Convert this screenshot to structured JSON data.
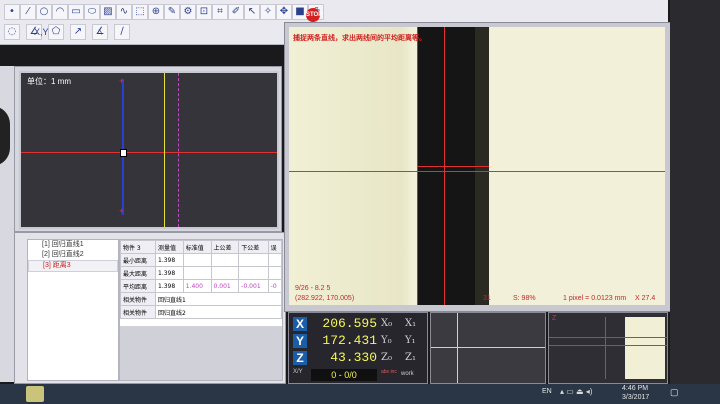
{
  "toolbar": {
    "row1_icons": [
      "point-icon",
      "line-icon",
      "circle-icon",
      "arc-icon",
      "rect-icon",
      "ellipse-icon",
      "hatch-icon",
      "curve-icon",
      "select-icon",
      "measure-icon",
      "edit-icon",
      "gear-icon",
      "frame-icon",
      "crop-icon",
      "pen-icon",
      "cursor-icon",
      "compass-icon",
      "pan-icon",
      "stop-icon",
      "print-icon"
    ],
    "row2_icons": [
      "lasso-icon",
      "angle-icon",
      "polygon-icon",
      "arrow-icon",
      "angle2-icon",
      "slash-icon"
    ],
    "xy_label": "X,Y",
    "stop_label": "STOP"
  },
  "left_view": {
    "unit_label": "单位：1 mm"
  },
  "right_view": {
    "instruction": "捕捉两条直线，求出两线间的平均距离等。",
    "coord_left": "9/26 - 8.2 5",
    "coord_right": "(282.922, 170.005)",
    "status_31": "31",
    "status_pct": "S: 98%",
    "status_pixel": "1 pixel = 0.0123 mm",
    "status_x": "X 27.4"
  },
  "tree": {
    "items": [
      {
        "index": "[1]",
        "label": "回归直线1"
      },
      {
        "index": "[2]",
        "label": "回归直线2"
      },
      {
        "index": "[3]",
        "label": "距离3"
      }
    ]
  },
  "results": {
    "headers": [
      "物件 3",
      "测量值",
      "标准值",
      "上公差",
      "下公差",
      "误"
    ],
    "rows": [
      {
        "name": "最小距离",
        "measured": "1.398",
        "nominal": "",
        "upper": "",
        "lower": ""
      },
      {
        "name": "最大距离",
        "measured": "1.398",
        "nominal": "",
        "upper": "",
        "lower": ""
      },
      {
        "name": "平均距离",
        "measured": "1.398",
        "nominal": "1.400",
        "upper": "0.001",
        "lower": "-0.001",
        "err": "-0"
      }
    ],
    "related": [
      {
        "label": "相关物件",
        "value": "回归直线1"
      },
      {
        "label": "相关物件",
        "value": "回归直线2"
      }
    ]
  },
  "dro": {
    "x": "206.595",
    "y": "172.431",
    "z": "43.330",
    "x_label": "X",
    "y_label": "Y",
    "z_label": "Z",
    "counter": "0 - 0/0",
    "work_label": "work",
    "inc_label": "abs inc",
    "xy_mini": "X/Y",
    "x0": "X₀",
    "y0": "Y₀",
    "z0": "Z₀",
    "x1": "X₁",
    "y1": "Y₁",
    "z1": "Z₁"
  },
  "mini_views": {
    "z_label": "Z"
  },
  "taskbar": {
    "lang": "EN",
    "time": "4:46 PM",
    "date": "3/3/2017"
  },
  "colors": {
    "accent_red": "#e03030",
    "crosshair_yellow": "#e6e03a",
    "magenta": "#c04ac0",
    "dro_yellow": "#f6f65a"
  }
}
